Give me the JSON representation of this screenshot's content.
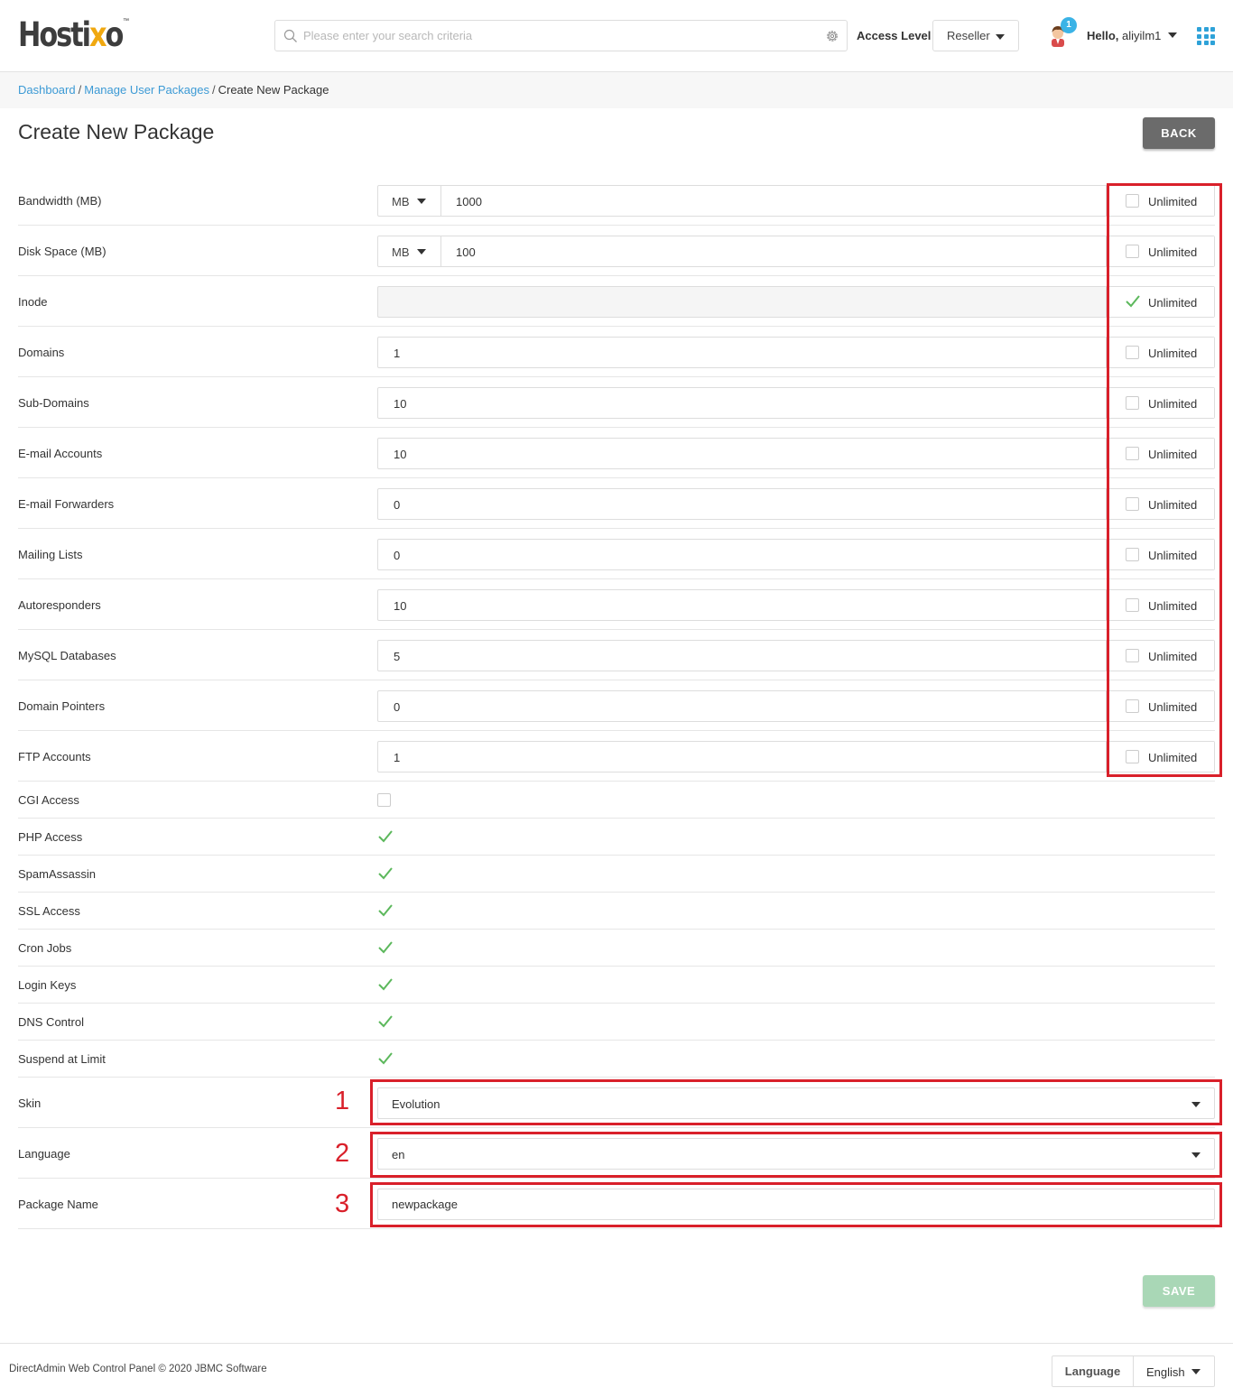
{
  "header": {
    "logo": "Hostixo",
    "search_placeholder": "Please enter your search criteria",
    "access_level_label": "Access Level",
    "access_level_value": "Reseller",
    "notification_count": "1",
    "hello_prefix": "Hello,",
    "username": "aliyilm1"
  },
  "breadcrumb": {
    "items": [
      "Dashboard",
      "Manage User Packages"
    ],
    "current": "Create New Package",
    "separator": "/"
  },
  "page": {
    "title": "Create New Package",
    "back_label": "BACK",
    "save_label": "SAVE"
  },
  "limits": [
    {
      "label": "Bandwidth (MB)",
      "unit": "MB",
      "value": "1000",
      "unlimited": false,
      "unlimited_label": "Unlimited"
    },
    {
      "label": "Disk Space (MB)",
      "unit": "MB",
      "value": "100",
      "unlimited": false,
      "unlimited_label": "Unlimited"
    },
    {
      "label": "Inode",
      "value": "",
      "unlimited": true,
      "unlimited_label": "Unlimited"
    },
    {
      "label": "Domains",
      "value": "1",
      "unlimited": false,
      "unlimited_label": "Unlimited"
    },
    {
      "label": "Sub-Domains",
      "value": "10",
      "unlimited": false,
      "unlimited_label": "Unlimited"
    },
    {
      "label": "E-mail Accounts",
      "value": "10",
      "unlimited": false,
      "unlimited_label": "Unlimited"
    },
    {
      "label": "E-mail Forwarders",
      "value": "0",
      "unlimited": false,
      "unlimited_label": "Unlimited"
    },
    {
      "label": "Mailing Lists",
      "value": "0",
      "unlimited": false,
      "unlimited_label": "Unlimited"
    },
    {
      "label": "Autoresponders",
      "value": "10",
      "unlimited": false,
      "unlimited_label": "Unlimited"
    },
    {
      "label": "MySQL Databases",
      "value": "5",
      "unlimited": false,
      "unlimited_label": "Unlimited"
    },
    {
      "label": "Domain Pointers",
      "value": "0",
      "unlimited": false,
      "unlimited_label": "Unlimited"
    },
    {
      "label": "FTP Accounts",
      "value": "1",
      "unlimited": false,
      "unlimited_label": "Unlimited"
    }
  ],
  "features": [
    {
      "label": "CGI Access",
      "checked": false
    },
    {
      "label": "PHP Access",
      "checked": true
    },
    {
      "label": "SpamAssassin",
      "checked": true
    },
    {
      "label": "SSL Access",
      "checked": true
    },
    {
      "label": "Cron Jobs",
      "checked": true
    },
    {
      "label": "Login Keys",
      "checked": true
    },
    {
      "label": "DNS Control",
      "checked": true
    },
    {
      "label": "Suspend at Limit",
      "checked": true
    }
  ],
  "settings": {
    "skin_label": "Skin",
    "skin_value": "Evolution",
    "language_label": "Language",
    "language_value": "en",
    "package_name_label": "Package Name",
    "package_name_value": "newpackage"
  },
  "annotations": {
    "markers": [
      "1",
      "2",
      "3"
    ],
    "color": "#d9202a"
  },
  "footer": {
    "copyright": "DirectAdmin Web Control Panel © 2020 JBMC Software",
    "language_label": "Language",
    "language_value": "English"
  },
  "colors": {
    "link": "#3c9ad5",
    "check": "#5cb85c",
    "back_button": "#6b6b6b",
    "save_button": "#a9d7b6",
    "badge": "#3bb3e6"
  }
}
